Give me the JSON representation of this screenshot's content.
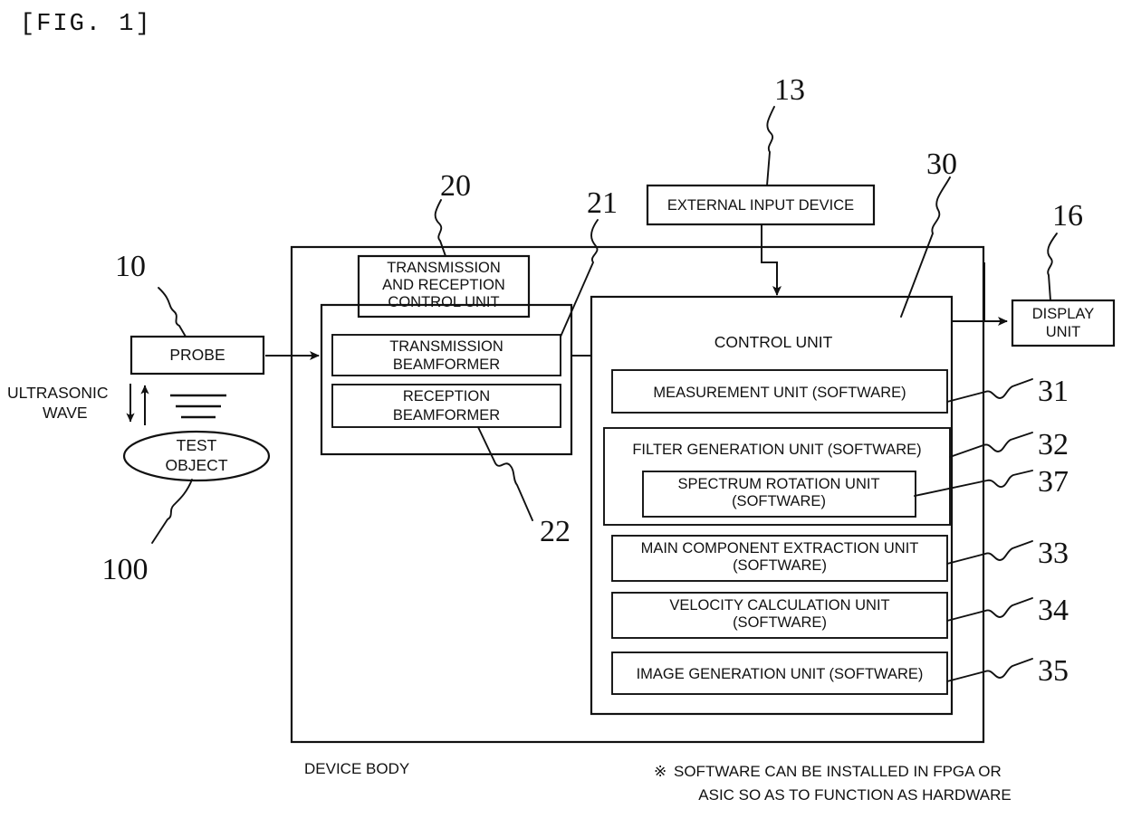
{
  "figure": {
    "label": "[FIG. 1]"
  },
  "blocks": {
    "probe": "PROBE",
    "test_object_line1": "TEST",
    "test_object_line2": "OBJECT",
    "ultrasonic_line1": "ULTRASONIC",
    "ultrasonic_line2": "WAVE",
    "txrx_control_line1": "TRANSMISSION",
    "txrx_control_line2": "AND RECEPTION",
    "txrx_control_line3": "CONTROL UNIT",
    "tx_beamformer_line1": "TRANSMISSION",
    "tx_beamformer_line2": "BEAMFORMER",
    "rx_beamformer_line1": "RECEPTION",
    "rx_beamformer_line2": "BEAMFORMER",
    "external_input_device": "EXTERNAL INPUT DEVICE",
    "display_unit_line1": "DISPLAY",
    "display_unit_line2": "UNIT",
    "control_unit": "CONTROL UNIT",
    "measurement_unit": "MEASUREMENT UNIT (SOFTWARE)",
    "filter_generation_unit": "FILTER GENERATION UNIT (SOFTWARE)",
    "spectrum_rotation_line1": "SPECTRUM ROTATION UNIT",
    "spectrum_rotation_line2": "(SOFTWARE)",
    "main_component_line1": "MAIN COMPONENT EXTRACTION UNIT",
    "main_component_line2": "(SOFTWARE)",
    "velocity_calculation_line1": "VELOCITY CALCULATION UNIT",
    "velocity_calculation_line2": "(SOFTWARE)",
    "image_generation_unit": "IMAGE GENERATION UNIT (SOFTWARE)",
    "device_body": "DEVICE BODY"
  },
  "reference_numerals": {
    "probe": "10",
    "test_object": "100",
    "txrx_control": "20",
    "tx_beamformer": "21",
    "rx_beamformer": "22",
    "external_input_device": "13",
    "control_unit": "30",
    "display_unit": "16",
    "measurement_unit": "31",
    "filter_generation_unit": "32",
    "spectrum_rotation_unit": "37",
    "main_component_unit": "33",
    "velocity_calculation_unit": "34",
    "image_generation_unit": "35"
  },
  "footnote": {
    "mark": "※",
    "line1": "SOFTWARE CAN BE INSTALLED IN FPGA OR",
    "line2": "ASIC SO AS TO FUNCTION AS HARDWARE"
  },
  "colors": {
    "ink": "#111111",
    "background": "#ffffff"
  }
}
